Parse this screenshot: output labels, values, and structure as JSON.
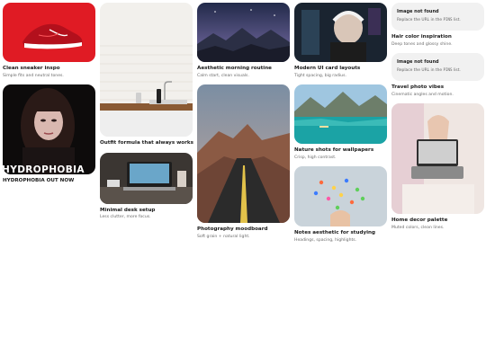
{
  "pins": [
    {
      "title": "Clean sneaker inspo",
      "subtitle": "Simple fits and neutral tones."
    },
    {
      "title": "HYDROPHOBIA OUT NOW",
      "overlay": "HYDROPHOBIA"
    },
    {
      "title": "Outfit formula that always works"
    },
    {
      "title": "Minimal desk setup",
      "subtitle": "Less clutter, more focus."
    },
    {
      "title": "Aesthetic morning routine",
      "subtitle": "Calm start, clean visuals."
    },
    {
      "title": "Photography moodboard",
      "subtitle": "Soft grain + natural light."
    },
    {
      "title": "Modern UI card layouts",
      "subtitle": "Tight spacing, big radius."
    },
    {
      "title": "Nature shots for wallpapers",
      "subtitle": "Crisp, high contrast."
    },
    {
      "title": "Notes aesthetic for studying",
      "subtitle": "Headings, spacing, highlights."
    },
    {
      "title": "Hair color inspiration",
      "subtitle": "Deep tones and glossy shine.",
      "error_title": "Image not found",
      "error_prefix": "Replace the URL in the",
      "error_code": "PINS",
      "error_suffix": "list."
    },
    {
      "title": "Travel photo vibes",
      "subtitle": "Cinematic angles and motion.",
      "error_title": "Image not found",
      "error_prefix": "Replace the URL in the",
      "error_code": "PINS",
      "error_suffix": "list."
    },
    {
      "title": "Home decor palette",
      "subtitle": "Muted colors, clean lines."
    }
  ]
}
